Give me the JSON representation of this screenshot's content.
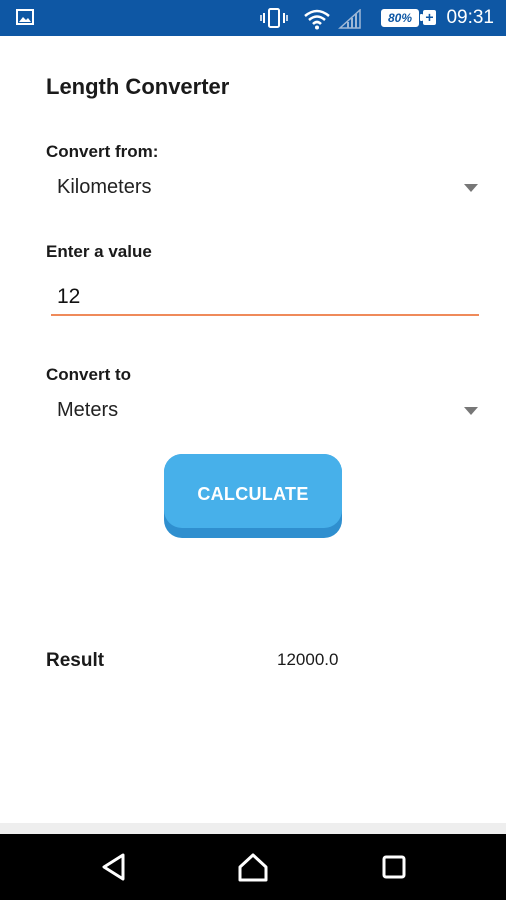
{
  "status_bar": {
    "time": "09:31",
    "battery_percent": "80%",
    "battery_charging_symbol": "+",
    "icons": [
      "gallery-icon",
      "vibrate-icon",
      "wifi-icon",
      "signal-icon",
      "battery-icon"
    ],
    "background_color": "#0e57a4"
  },
  "app": {
    "title": "Length Converter"
  },
  "form": {
    "convert_from_label": "Convert from:",
    "convert_from_value": "Kilometers",
    "enter_value_label": "Enter a value",
    "value_input": "12",
    "convert_to_label": "Convert to",
    "convert_to_value": "Meters",
    "calculate_button": "CALCULATE",
    "input_underline_color": "#ef8a5a",
    "button_color": "#47b0ea"
  },
  "result": {
    "label": "Result",
    "value": "12000.0"
  },
  "nav_bar": {
    "buttons": [
      "back-icon",
      "home-icon",
      "recents-icon"
    ]
  }
}
